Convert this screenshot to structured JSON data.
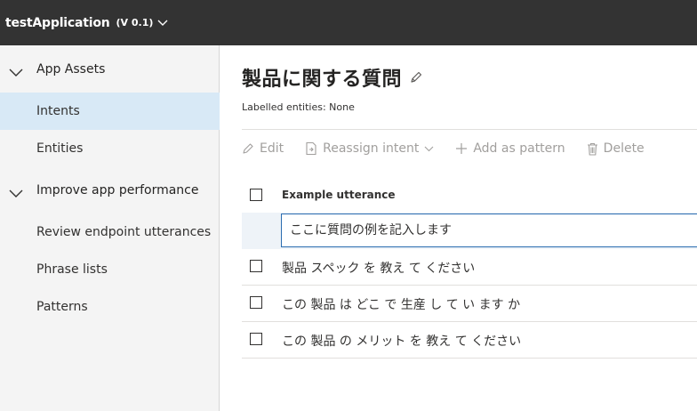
{
  "app": {
    "name": "testApplication",
    "version": "(V 0.1)"
  },
  "sidebar": {
    "sections": [
      {
        "label": "App Assets",
        "items": [
          {
            "label": "Intents"
          },
          {
            "label": "Entities"
          }
        ]
      },
      {
        "label": "Improve app performance",
        "items": [
          {
            "label": "Review endpoint utterances"
          },
          {
            "label": "Phrase lists"
          },
          {
            "label": "Patterns"
          }
        ]
      }
    ],
    "active_item": "Intents"
  },
  "main": {
    "title": "製品に関する質問",
    "labelled_entities": "Labelled entities: None",
    "toolbar": {
      "edit": "Edit",
      "reassign": "Reassign intent",
      "add_pattern": "Add as pattern",
      "delete": "Delete"
    },
    "table": {
      "column_header": "Example utterance",
      "input_placeholder": "ここに質問の例を記入します",
      "rows": [
        "製品 スペック を 教え て ください",
        "この 製品 は どこ で 生産 し て い ます か",
        "この 製品 の メリット を 教え て ください"
      ]
    }
  },
  "colors": {
    "topbar": "#333333",
    "sidebar": "#f4f4f4",
    "active_nav": "#d8e9f6",
    "input_border": "#2b6cb0",
    "disabled_text": "#a19f9d"
  },
  "icons": [
    "chevron-down-icon",
    "pencil-icon",
    "edit-icon",
    "reassign-icon",
    "plus-icon",
    "delete-icon"
  ]
}
